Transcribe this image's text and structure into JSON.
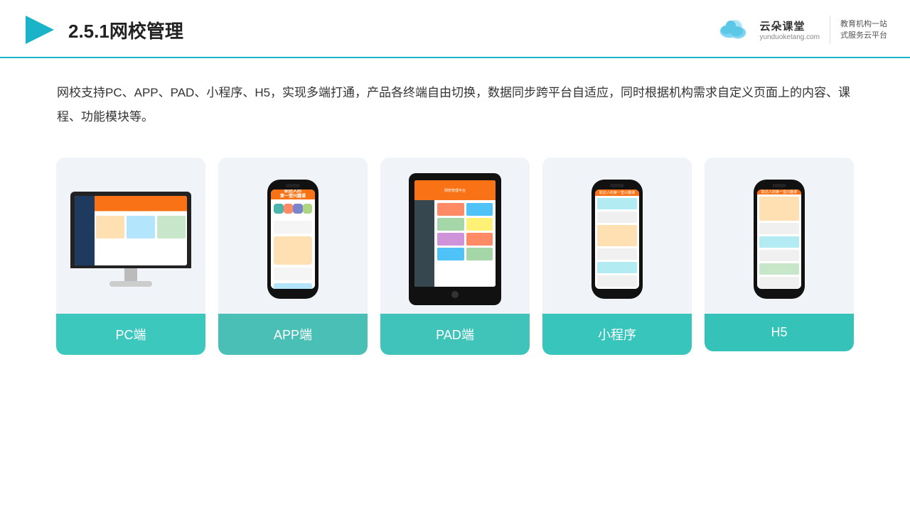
{
  "header": {
    "title": "2.5.1网校管理",
    "logo_brand": "云朵课堂",
    "logo_url": "yunduoketang.com",
    "logo_slogan": "教育机构一站\n式服务云平台"
  },
  "description": {
    "text": "网校支持PC、APP、PAD、小程序、H5，实现多端打通，产品各终端自由切换，数据同步跨平台自适应，同时根据机构需求自定义页面上的内容、课程、功能模块等。"
  },
  "cards": [
    {
      "id": "pc",
      "label": "PC端"
    },
    {
      "id": "app",
      "label": "APP端"
    },
    {
      "id": "pad",
      "label": "PAD端"
    },
    {
      "id": "miniprogram",
      "label": "小程序"
    },
    {
      "id": "h5",
      "label": "H5"
    }
  ]
}
